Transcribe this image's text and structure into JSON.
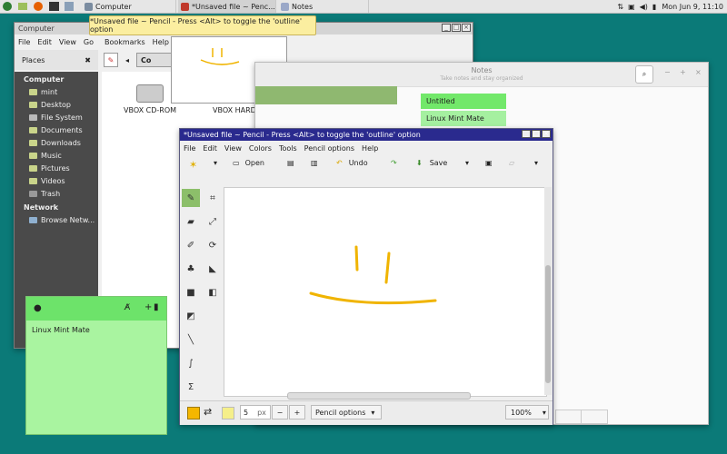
{
  "panel": {
    "tasks": [
      "Computer",
      "*Unsaved file ~ Penc...",
      "Notes"
    ],
    "clock": "Mon Jun 9, 11:10"
  },
  "tooltip": "*Unsaved file ~ Pencil - Press <Alt> to toggle the 'outline' option",
  "file_manager": {
    "title": "Computer",
    "menu": [
      "File",
      "Edit",
      "View",
      "Go",
      "Bookmarks",
      "Help"
    ],
    "places_label": "Places",
    "location": "Co",
    "sections": [
      {
        "heading": "Computer",
        "items": [
          "mint",
          "Desktop",
          "File System",
          "Documents",
          "Downloads",
          "Music",
          "Pictures",
          "Videos",
          "Trash"
        ]
      },
      {
        "heading": "Network",
        "items": [
          "Browse Netw..."
        ]
      }
    ],
    "drives": [
      "VBOX CD-ROM",
      "VBOX HARD"
    ]
  },
  "notes_app": {
    "title": "Notes",
    "subtitle": "Take notes and stay organized",
    "notes": [
      "Untitled",
      "Linux Mint Mate"
    ]
  },
  "pencil": {
    "title": "*Unsaved file ~ Pencil - Press <Alt> to toggle the 'outline' option",
    "menu": [
      "File",
      "Edit",
      "View",
      "Colors",
      "Tools",
      "Pencil options",
      "Help"
    ],
    "toolbar": {
      "open": "Open",
      "undo": "Undo",
      "save": "Save"
    },
    "size_value": "5",
    "size_unit": "px",
    "minus": "−",
    "plus": "+",
    "options_label": "Pencil options",
    "zoom": "100%",
    "colors": {
      "primary": "#f5b700",
      "secondary": "#f5ef8a"
    }
  },
  "sticky": {
    "text": "Linux Mint Mate",
    "color": "#a9f4a0"
  }
}
